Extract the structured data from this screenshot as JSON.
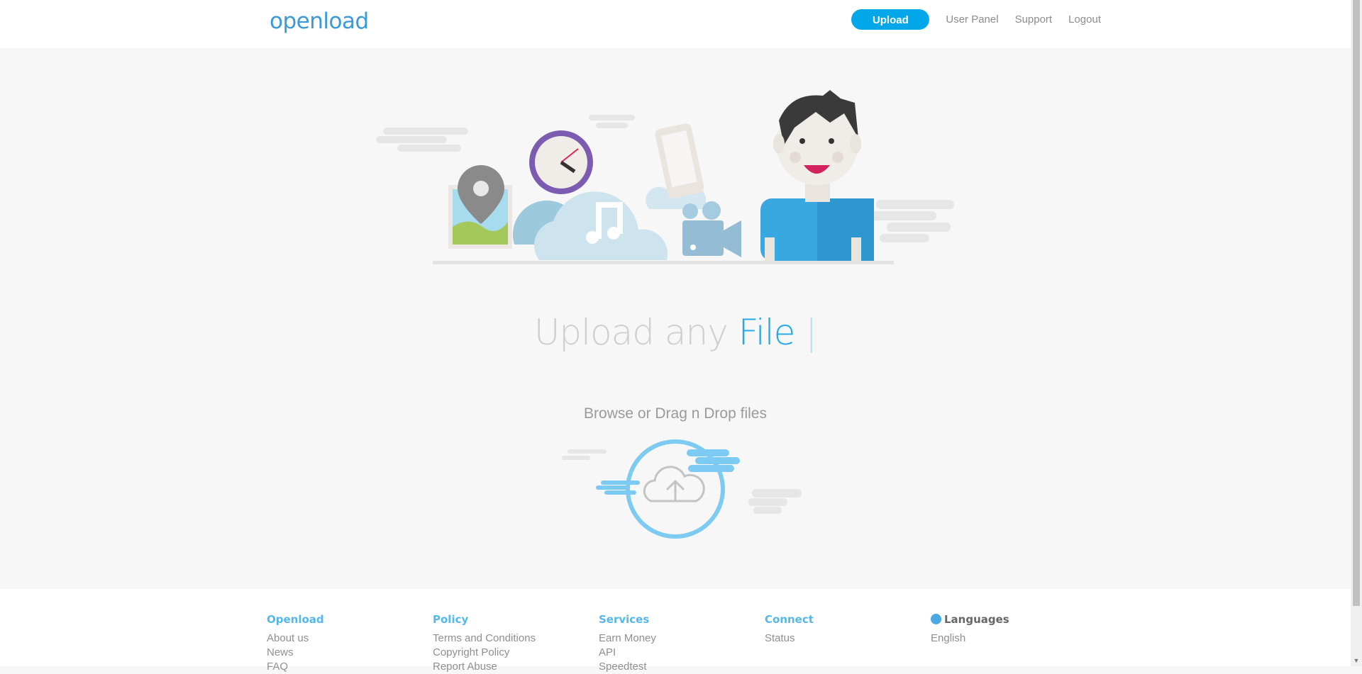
{
  "header": {
    "logo_text": "openload",
    "upload_label": "Upload",
    "nav": [
      "User Panel",
      "Support",
      "Logout"
    ]
  },
  "hero": {
    "headline_part1": "Upload any",
    "headline_accent": "File",
    "caret": "|",
    "browse_text": "Browse or Drag n Drop files"
  },
  "footer": {
    "columns": [
      {
        "title": "Openload",
        "links": [
          "About us",
          "News",
          "FAQ"
        ]
      },
      {
        "title": "Policy",
        "links": [
          "Terms and Conditions",
          "Copyright Policy",
          "Report Abuse"
        ]
      },
      {
        "title": "Services",
        "links": [
          "Earn Money",
          "API",
          "Speedtest"
        ]
      },
      {
        "title": "Connect",
        "links": [
          "Status"
        ]
      },
      {
        "title": "Languages",
        "links": [
          "English"
        ]
      }
    ]
  },
  "colors": {
    "accent": "#02a7ea",
    "headline_accent": "#22a9e6",
    "footer_title": "#56b8ea"
  }
}
